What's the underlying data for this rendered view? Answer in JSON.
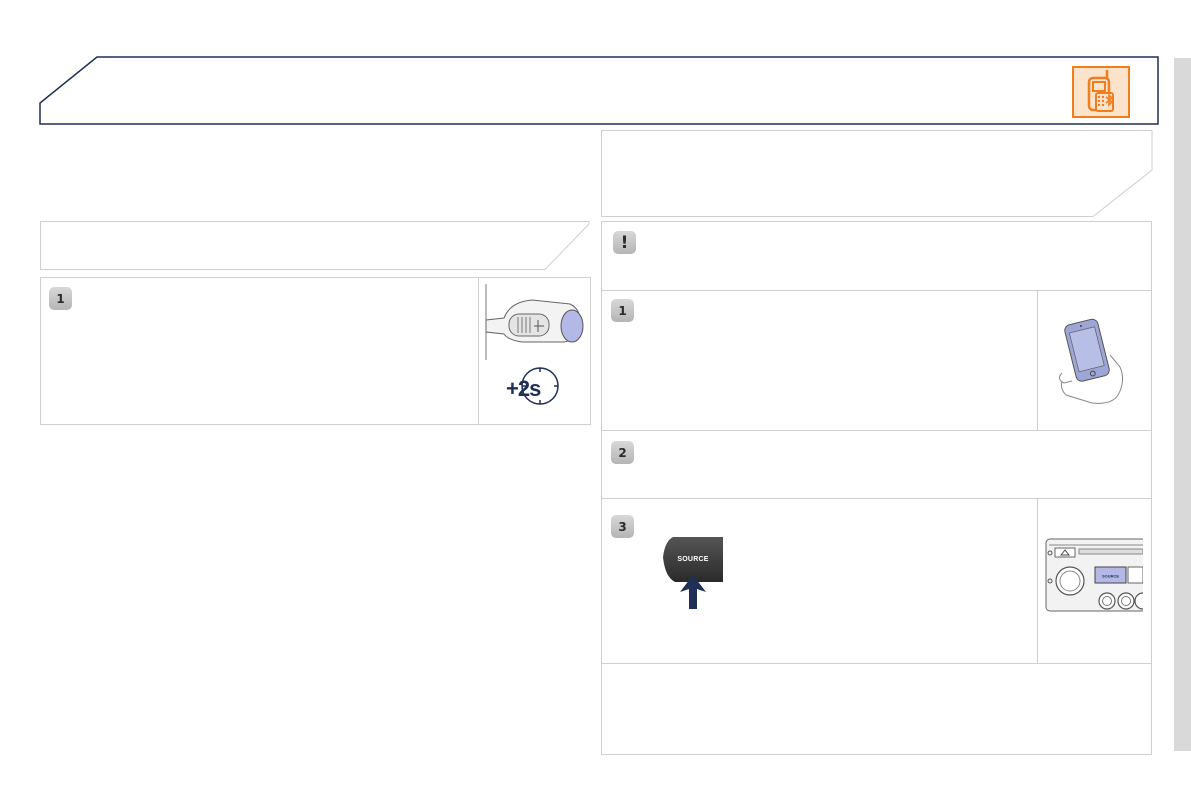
{
  "header": {
    "icon": "phone-bluetooth-icon",
    "accent_color": "#f07d1e",
    "border_color": "#1f2f57"
  },
  "left_panel": {
    "step_1": {
      "badge": "1",
      "duration_label": "+2s",
      "illustration": "steering-control-stalk"
    }
  },
  "right_panel": {
    "warning_icon": "exclamation-icon",
    "warning_symbol": "!",
    "step_1": {
      "badge": "1",
      "illustration": "smartphone-in-hand"
    },
    "step_2": {
      "badge": "2"
    },
    "step_3": {
      "badge": "3",
      "source_button_label": "SOURCE",
      "illustration": "audio-system-front-panel"
    }
  },
  "colors": {
    "scrollbar": "#d9d9d9",
    "box_border": "#cfcfcf",
    "navy": "#1f2f57"
  }
}
